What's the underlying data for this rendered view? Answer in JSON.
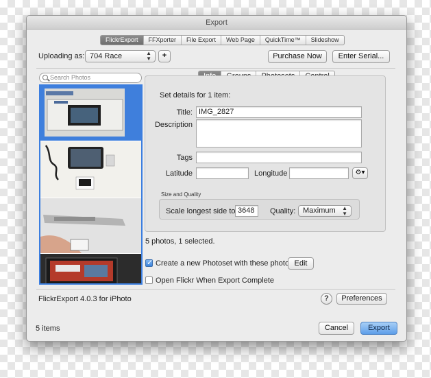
{
  "window": {
    "title": "Export"
  },
  "tabs": [
    {
      "label": "FlickrExport",
      "active": true
    },
    {
      "label": "FFXporter",
      "active": false
    },
    {
      "label": "File Export",
      "active": false
    },
    {
      "label": "Web Page",
      "active": false
    },
    {
      "label": "QuickTime™",
      "active": false
    },
    {
      "label": "Slideshow",
      "active": false
    }
  ],
  "account": {
    "label": "Uploading as:",
    "value": "704 Race",
    "add_label": "+",
    "purchase_label": "Purchase Now",
    "serial_label": "Enter Serial..."
  },
  "search": {
    "placeholder": "Search Photos"
  },
  "photos": [
    "IMG_2827",
    "photo-2",
    "photo-3",
    "photo-4"
  ],
  "subtabs": [
    {
      "label": "Info",
      "active": true
    },
    {
      "label": "Groups",
      "active": false
    },
    {
      "label": "Photosets",
      "active": false
    },
    {
      "label": "Control",
      "active": false
    }
  ],
  "details": {
    "heading": "Set details for 1 item:",
    "title_label": "Title:",
    "title_value": "IMG_2827",
    "description_label": "Description",
    "description_value": "",
    "tags_label": "Tags",
    "tags_value": "",
    "latitude_label": "Latitude",
    "latitude_value": "",
    "longitude_label": "Longitude",
    "longitude_value": ""
  },
  "size_quality": {
    "group_label": "Size and Quality",
    "scale_label": "Scale longest side to:",
    "scale_value": "3648",
    "quality_label": "Quality:",
    "quality_value": "Maximum"
  },
  "selection_status": "5 photos, 1 selected.",
  "photoset": {
    "create_label": "Create a new Photoset with these photos",
    "create_checked": true,
    "edit_label": "Edit",
    "open_label": "Open Flickr When Export Complete",
    "open_checked": false
  },
  "footer": {
    "version": "FlickrExport 4.0.3 for iPhoto",
    "help_label": "?",
    "preferences_label": "Preferences",
    "item_count": "5 items",
    "cancel_label": "Cancel",
    "export_label": "Export"
  },
  "colors": {
    "selection": "#3b7ee0",
    "default_button": "#5e9ee9"
  }
}
